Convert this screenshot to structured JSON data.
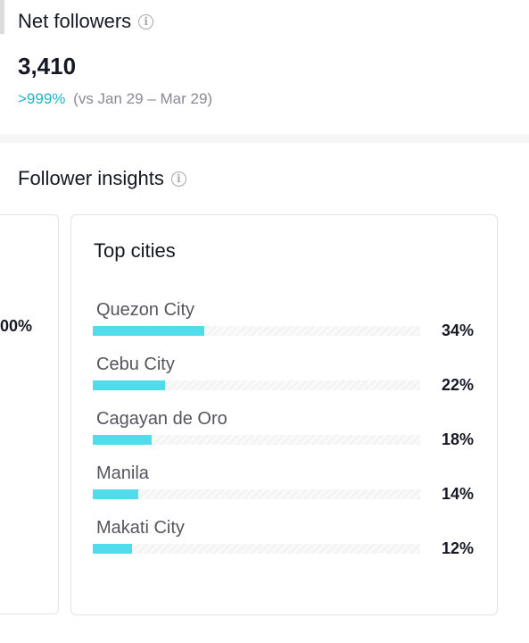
{
  "net_followers": {
    "title": "Net followers",
    "info_icon": "i",
    "value": "3,410",
    "change": ">999%",
    "comparison": "(vs Jan 29 – Mar 29)"
  },
  "follower_insights": {
    "title": "Follower insights",
    "info_icon": "i",
    "partial_card_text": "00%",
    "top_cities": {
      "title": "Top cities",
      "cities": [
        {
          "name": "Quezon City",
          "percent": 34,
          "label": "34%"
        },
        {
          "name": "Cebu City",
          "percent": 22,
          "label": "22%"
        },
        {
          "name": "Cagayan de Oro",
          "percent": 18,
          "label": "18%"
        },
        {
          "name": "Manila",
          "percent": 14,
          "label": "14%"
        },
        {
          "name": "Makati City",
          "percent": 12,
          "label": "12%"
        }
      ]
    }
  },
  "colors": {
    "accent": "#20b4c8",
    "bar_fill": "#50dcea",
    "text_primary": "#161823",
    "text_secondary": "#8a8b91"
  }
}
